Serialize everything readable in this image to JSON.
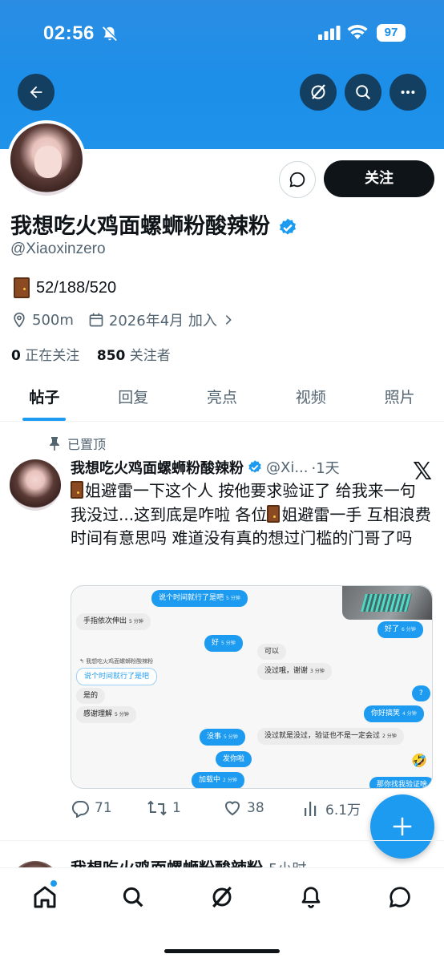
{
  "status_bar": {
    "time": "02:56",
    "battery": "97"
  },
  "header": {
    "back_icon": "arrow-left-icon",
    "grok_icon": "grok-icon",
    "search_icon": "search-icon",
    "more_icon": "more-icon"
  },
  "profile": {
    "name": "我想吃火鸡面螺蛳粉酸辣粉",
    "handle": "@Xiaoxinzero",
    "bio": "52/188/520",
    "location": "500m",
    "joined": "2026年4月 加入",
    "following_count": "0",
    "following_label": "正在关注",
    "followers_count": "850",
    "followers_label": "关注者",
    "follow_label": "关注"
  },
  "tabs": [
    {
      "label": "帖子"
    },
    {
      "label": "回复"
    },
    {
      "label": "亮点"
    },
    {
      "label": "视频"
    },
    {
      "label": "照片"
    }
  ],
  "post": {
    "pinned_label": "已置顶",
    "author": "我想吃火鸡面螺蛳粉酸辣粉",
    "handle": "@Xi...",
    "time": "·1天",
    "text1": "姐避雷一下这个人 按他要求验证了 给我来一句我没过...这到底是咋啦 各位",
    "text2": "姐避雷一手 互相浪费时间有意思吗 难道没有真的想过门槛的门哥了吗",
    "replies": "71",
    "reposts": "1",
    "likes": "38",
    "views": "6.1万"
  },
  "chat": {
    "m1": "说个时间就行了是吧",
    "m2": "手指依次伸出",
    "m3": "好",
    "quote_name": "我想吃火鸡面螺蛳粉酸辣粉",
    "m4": "说个时间就行了是吧",
    "m5": "是的",
    "m6": "感谢理解",
    "m7": "没事",
    "m8": "发你啦",
    "m9": "加载中",
    "m10": "可以",
    "m11": "没过哦，谢谢",
    "m12": "没过就是没过，验证也不是一定会过",
    "m13": "好了",
    "m14": "?",
    "m15": "你好搞笑",
    "m16": "那你找我验证啥",
    "t5": "5 分钟",
    "t6": "6 分钟",
    "t4": "4 分钟",
    "t2": "2 分钟",
    "t3": "3 分钟"
  },
  "next_post": {
    "author": "我想吃火鸡面螺蛳粉酸辣粉",
    "time": "5小时"
  },
  "nav": [
    "home-icon",
    "search-icon",
    "grok-icon",
    "notifications-icon",
    "messages-icon"
  ]
}
